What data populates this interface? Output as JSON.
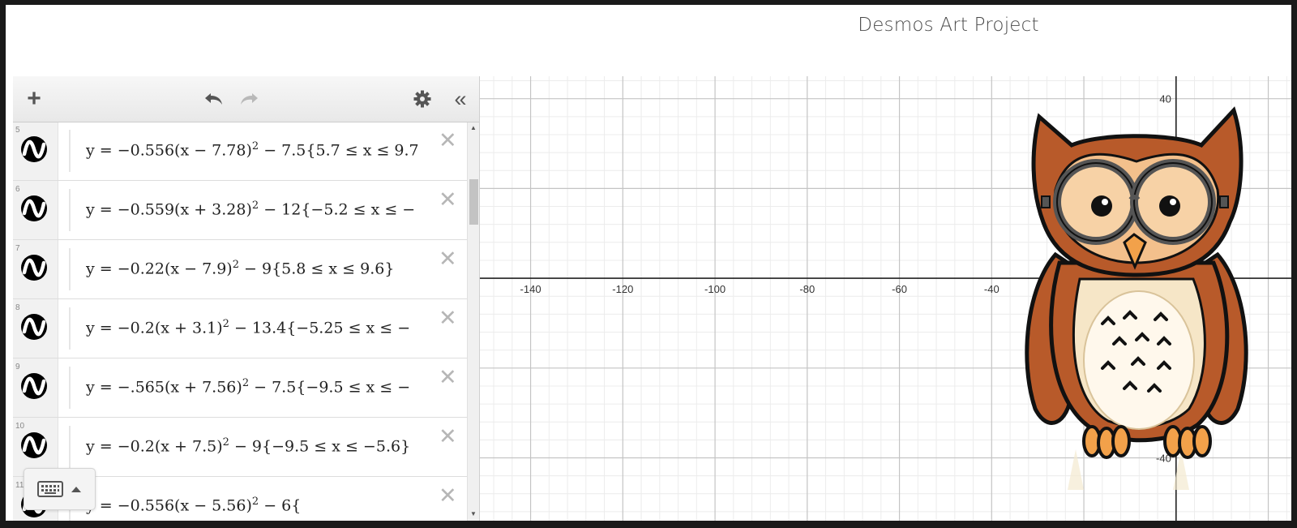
{
  "page": {
    "title": "Desmos Art Project"
  },
  "toolbar": {
    "add_icon": "plus-icon",
    "undo_icon": "undo-icon",
    "redo_icon": "redo-icon",
    "settings_icon": "gear-icon",
    "collapse_icon": "double-chevron-left-icon"
  },
  "expressions": [
    {
      "number": "5",
      "latex": "y = -0.556(x - 7.78)^2 - 7.5{5.7 ≤ x ≤ 9.7",
      "lead": "y = −0.556(x − 7.78)",
      "exp": "2",
      "tail": " − 7.5{5.7 ≤ x ≤ 9.7"
    },
    {
      "number": "6",
      "latex": "y = -0.559(x + 3.28)^2 - 12{-5.2 ≤ x ≤ -",
      "lead": "y = −0.559(x + 3.28)",
      "exp": "2",
      "tail": " − 12{−5.2 ≤ x ≤ −"
    },
    {
      "number": "7",
      "latex": "y = -0.22(x - 7.9)^2 - 9{5.8 ≤ x ≤ 9.6}",
      "lead": "y = −0.22(x − 7.9)",
      "exp": "2",
      "tail": " − 9{5.8 ≤ x ≤ 9.6}"
    },
    {
      "number": "8",
      "latex": "y = -0.2(x + 3.1)^2 - 13.4{-5.25 ≤ x ≤ -",
      "lead": "y = −0.2(x + 3.1)",
      "exp": "2",
      "tail": " − 13.4{−5.25 ≤ x ≤ −"
    },
    {
      "number": "9",
      "latex": "y = -.565(x + 7.56)^2 - 7.5{-9.5 ≤ x ≤ -",
      "lead": "y = −.565(x + 7.56)",
      "exp": "2",
      "tail": " − 7.5{−9.5 ≤ x ≤ −"
    },
    {
      "number": "10",
      "latex": "y = -0.2(x + 7.5)^2 - 9{-9.5 ≤ x ≤ -5.6}",
      "lead": "y = −0.2(x + 7.5)",
      "exp": "2",
      "tail": " − 9{−9.5 ≤ x ≤ −5.6}"
    },
    {
      "number": "11",
      "latex": "y = -0.556(x - 5.56)^2 - 6{",
      "lead": "y = −0.556(x − 5.56)",
      "exp": "2",
      "tail": " − 6{"
    }
  ],
  "expression_icon": "desmos-wave-icon",
  "delete_icon": "close-icon",
  "delete_glyph": "✕",
  "keyboard": {
    "icon": "keyboard-icon",
    "caret_icon": "caret-up-icon"
  },
  "graph": {
    "x_ticks": [
      "-140",
      "-120",
      "-100",
      "-80",
      "-60",
      "-40"
    ],
    "y_ticks": [
      "40",
      "-40"
    ],
    "x_tick_values": [
      -140,
      -120,
      -100,
      -80,
      -60,
      -40
    ],
    "y_tick_values": [
      40,
      -40
    ],
    "x_range": [
      -151,
      25
    ],
    "y_range": [
      -54,
      45
    ],
    "colors": {
      "major_grid": "#c4c4c4",
      "minor_grid": "#ececec",
      "axis": "#222222"
    }
  },
  "owl_image": "owl-illustration"
}
